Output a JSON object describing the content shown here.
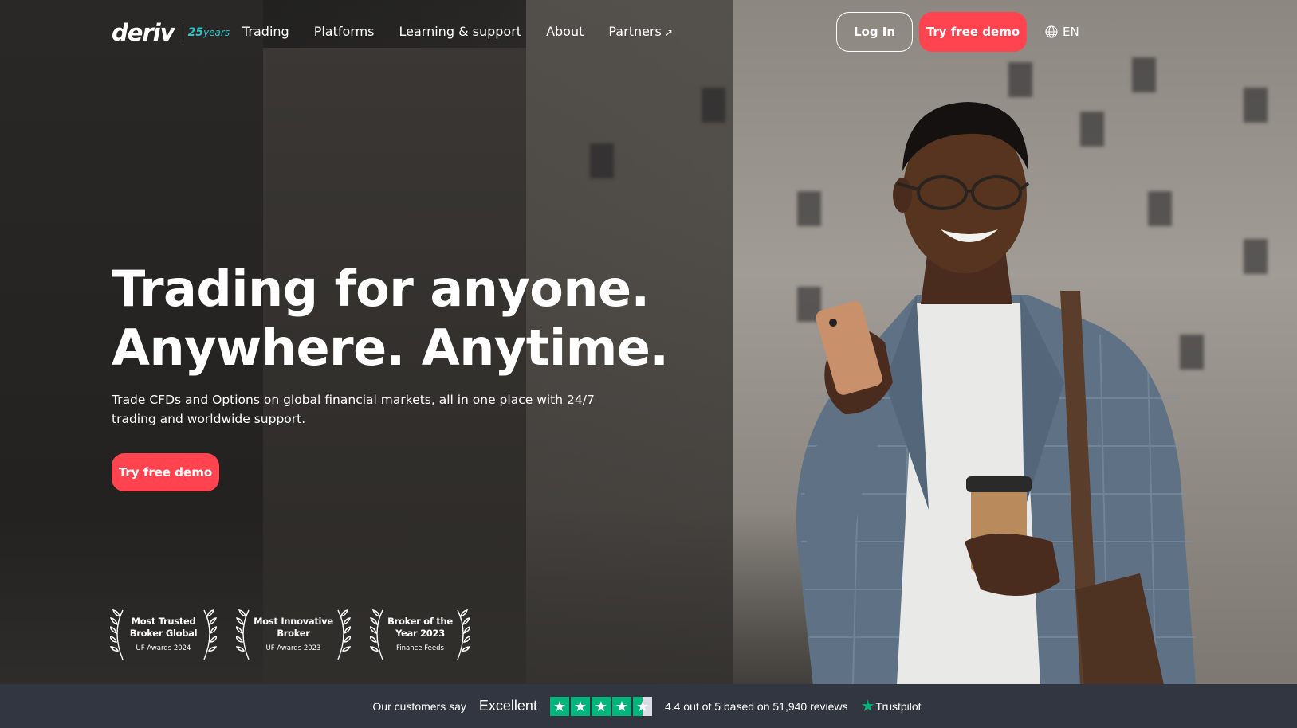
{
  "header": {
    "logo_text": "deriv",
    "logo_years_number": "25",
    "logo_years_word": "years",
    "nav": [
      {
        "label": "Trading"
      },
      {
        "label": "Platforms"
      },
      {
        "label": "Learning & support"
      },
      {
        "label": "About"
      },
      {
        "label": "Partners"
      }
    ],
    "login_label": "Log In",
    "demo_label": "Try free demo",
    "language": "EN"
  },
  "hero": {
    "headline_line1": "Trading for anyone.",
    "headline_line2": "Anywhere. Anytime.",
    "subtitle": "Trade CFDs and Options on global financial markets, all in one place with 24/7 trading and worldwide support.",
    "cta_label": "Try free demo"
  },
  "awards": [
    {
      "title_line1": "Most Trusted",
      "title_line2": "Broker Global",
      "source": "UF Awards 2024"
    },
    {
      "title_line1": "Most Innovative",
      "title_line2": "Broker",
      "source": "UF Awards 2023"
    },
    {
      "title_line1": "Broker of the",
      "title_line2": "Year 2023",
      "source": "Finance Feeds"
    }
  ],
  "trustpilot": {
    "customers_say": "Our customers say",
    "rating_word": "Excellent",
    "stars": 4.5,
    "rating_text": "4.4 out of 5 based on 51,940 reviews",
    "brand": "Trustpilot"
  },
  "colors": {
    "brand_red": "#ff444f",
    "teal": "#2ec4c9",
    "trustpilot_green": "#00b67a",
    "footer_bar": "#323640"
  },
  "icons": [
    "globe-icon",
    "external-arrow-icon",
    "laurel-icon",
    "star-icon",
    "trustpilot-star-icon"
  ]
}
